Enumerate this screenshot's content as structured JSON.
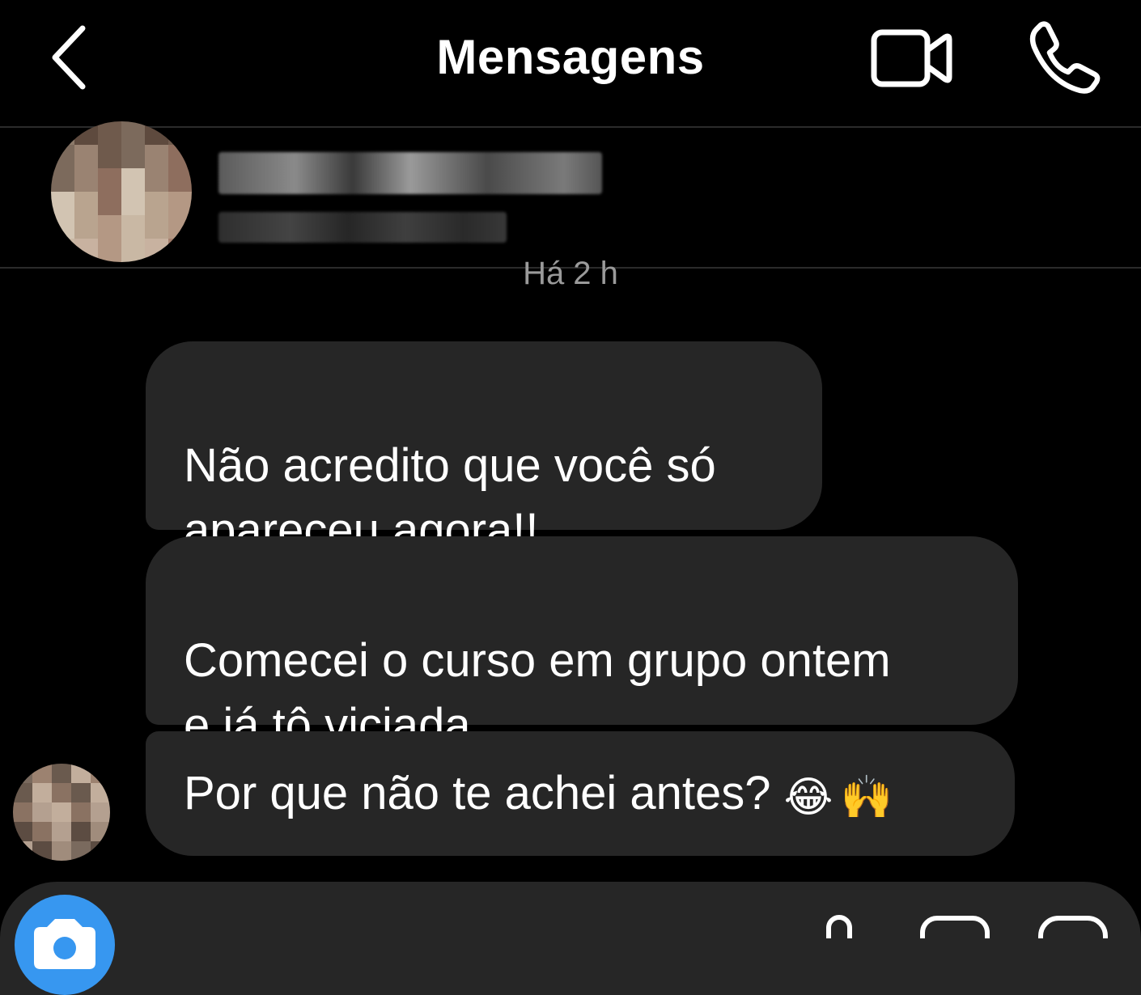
{
  "header": {
    "title": "Mensagens"
  },
  "conversation": {
    "timestamp": "Há 2 h",
    "messages": [
      {
        "lines": "Não acredito que você só\napareceu agora!!"
      },
      {
        "lines": "Comecei o curso em grupo ontem\ne já tô viciada"
      },
      {
        "text": "Por que não te achei antes? ",
        "emojis": [
          "😂",
          "🙌"
        ]
      }
    ]
  },
  "colors": {
    "background": "#000000",
    "bubble": "#262626",
    "accent_camera": "#3797f0",
    "timestamp_text": "#9a9a9a"
  },
  "icons": {
    "back": "chevron-left-icon",
    "video": "video-camera-icon",
    "phone": "phone-icon",
    "camera": "camera-icon",
    "mic": "microphone-icon",
    "gallery": "image-icon",
    "sticker": "sticker-icon"
  }
}
